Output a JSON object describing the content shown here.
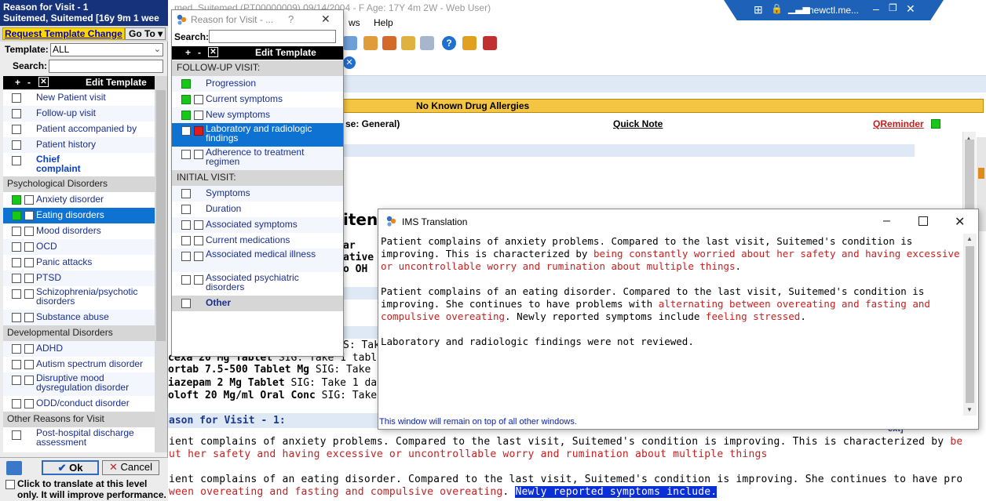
{
  "main": {
    "title": "med, Suitemed (PT00000009) 09/14/2004 - F Age: 17Y 4m 2W - Web User)",
    "menu": [
      "ws",
      "Help"
    ],
    "allergy": "No Known Drug Allergies",
    "header_left": "se: General)",
    "quick_note": "Quick Note",
    "qreminder": "QReminder",
    "partial_words": [
      "iten",
      "ar",
      "ative",
      "o OH",
      "S: Take",
      "ake 1 table",
      "S: Take 1",
      "Take 1 da",
      "ext]"
    ],
    "meds": [
      {
        "name": "cexa 20 Mg Tablet",
        "sig": "SIG: Take 1 table"
      },
      {
        "name": "ortab 7.5-500 Tablet Mg",
        "sig": "SIG: Take 1"
      },
      {
        "name": "iazepam 2 Mg Tablet",
        "sig": "SIG: Take 1 da"
      },
      {
        "name": "oloft 20 Mg/ml Oral Conc",
        "sig": "SIG: Take"
      }
    ],
    "reason_heading": "ason for Visit - 1:",
    "para1_a": "ient complains of anxiety problems. Compared to the last visit, Suitemed's condition is improving. This is characterized by ",
    "para1_red_a": "being constantly worried",
    "para1_red_b": "ut her safety and having excessive or uncontrollable worry and rumination about multiple things",
    "para2_a": "ient complains of an eating disorder. Compared to the last visit, Suitemed's condition is improving. She continues to have problems with ",
    "para2_red_a": "alternating",
    "para2_red_b": "ween overeating and fasting and compulsive overeating",
    "para2_hl": "Newly reported symptoms include."
  },
  "remote_bar": {
    "label": "newctl.me..."
  },
  "left_panel": {
    "title_line1": "Reason for Visit - 1",
    "title_line2": "Suitemed, Suitemed   [16y 9m 1 wee",
    "request_btn": "Request Template Change",
    "goto_btn": "Go To",
    "template_label": "Template:",
    "template_value": "ALL",
    "search_label": "Search:",
    "edit_template": "Edit Template",
    "items": [
      {
        "label": "New Patient visit",
        "type": "item",
        "cb": [
          "",
          null
        ]
      },
      {
        "label": "Follow-up visit",
        "type": "item",
        "cb": [
          "",
          null
        ]
      },
      {
        "label": "Patient accompanied by",
        "type": "item",
        "cb": [
          "",
          null
        ]
      },
      {
        "label": "Patient history",
        "type": "item",
        "cb": [
          "",
          null
        ]
      },
      {
        "label": "Chief complaint",
        "type": "chief",
        "cb": [
          "",
          null
        ]
      },
      {
        "label": "Psychological Disorders",
        "type": "hdr"
      },
      {
        "label": "Anxiety disorder",
        "type": "item",
        "cb": [
          "g",
          ""
        ]
      },
      {
        "label": "Eating disorders",
        "type": "sel",
        "cb": [
          "g",
          ""
        ]
      },
      {
        "label": "Mood disorders",
        "type": "item",
        "cb": [
          "",
          ""
        ]
      },
      {
        "label": "OCD",
        "type": "item",
        "cb": [
          "",
          ""
        ]
      },
      {
        "label": "Panic attacks",
        "type": "item",
        "cb": [
          "",
          ""
        ]
      },
      {
        "label": "PTSD",
        "type": "item",
        "cb": [
          "",
          ""
        ]
      },
      {
        "label": "Schizophrenia/psychotic disorders",
        "type": "two",
        "cb": [
          "",
          ""
        ]
      },
      {
        "label": "Substance abuse",
        "type": "item",
        "cb": [
          "",
          ""
        ]
      },
      {
        "label": "Developmental Disorders",
        "type": "hdr"
      },
      {
        "label": "ADHD",
        "type": "item",
        "cb": [
          "",
          ""
        ]
      },
      {
        "label": "Autism spectrum disorder",
        "type": "item",
        "cb": [
          "",
          ""
        ]
      },
      {
        "label": "Disruptive mood dysregulation disorder",
        "type": "two",
        "cb": [
          "",
          ""
        ]
      },
      {
        "label": "ODD/conduct disorder",
        "type": "item",
        "cb": [
          "",
          ""
        ]
      },
      {
        "label": "Other Reasons for Visit",
        "type": "hdr"
      },
      {
        "label": "Post-hospital discharge assessment",
        "type": "two",
        "cb": [
          "",
          null
        ]
      }
    ],
    "ok": "Ok",
    "cancel": "Cancel",
    "translate_text": "Click to translate at this level only. It will improve performance."
  },
  "rv_popup": {
    "title": "Reason for Visit - ...",
    "help": "?",
    "close": "✕",
    "search_label": "Search:",
    "edit_template": "Edit Template",
    "items": [
      {
        "label": "FOLLOW-UP VISIT:",
        "type": "hdr"
      },
      {
        "label": "Progression",
        "type": "item",
        "cb": [
          "g",
          null
        ]
      },
      {
        "label": "Current symptoms",
        "type": "item",
        "cb": [
          "g",
          ""
        ]
      },
      {
        "label": "New symptoms",
        "type": "item",
        "cb": [
          "g",
          ""
        ]
      },
      {
        "label": "Laboratory and radiologic findings",
        "type": "sel2",
        "cb": [
          "",
          "r"
        ]
      },
      {
        "label": "Adherence to treatment regimen",
        "type": "two",
        "cb": [
          "",
          ""
        ]
      },
      {
        "label": "INITIAL VISIT:",
        "type": "hdr"
      },
      {
        "label": "Symptoms",
        "type": "item",
        "cb": [
          "",
          null
        ]
      },
      {
        "label": "Duration",
        "type": "item",
        "cb": [
          "",
          null
        ]
      },
      {
        "label": "Associated symptoms",
        "type": "item",
        "cb": [
          "",
          ""
        ]
      },
      {
        "label": "Current medications",
        "type": "item",
        "cb": [
          "",
          ""
        ]
      },
      {
        "label": "Associated medical illness",
        "type": "two",
        "cb": [
          "",
          ""
        ]
      },
      {
        "label": "Associated psychiatric disorders",
        "type": "two",
        "cb": [
          "",
          ""
        ]
      },
      {
        "label": "Other",
        "type": "other",
        "cb": [
          "",
          null
        ]
      }
    ]
  },
  "ims": {
    "title": "IMS Translation",
    "p1_a": "Patient complains of anxiety problems. Compared to the last visit, Suitemed's condition is improving. This is characterized by ",
    "p1_red": "being constantly worried about her safety and having excessive or uncontrollable worry and rumination about multiple things",
    "p1_end": ".",
    "p2_a": "Patient complains of an eating disorder. Compared to the last visit, Suitemed's condition is improving. She continues to have problems with ",
    "p2_red": "alternating between overeating and fasting and compulsive overeating",
    "p2_b": ". Newly reported symptoms include ",
    "p2_red2": "feeling stressed",
    "p2_end": ".",
    "p3": "Laboratory and radiologic findings were not reviewed.",
    "footer": "This window will remain on top of all other windows."
  }
}
